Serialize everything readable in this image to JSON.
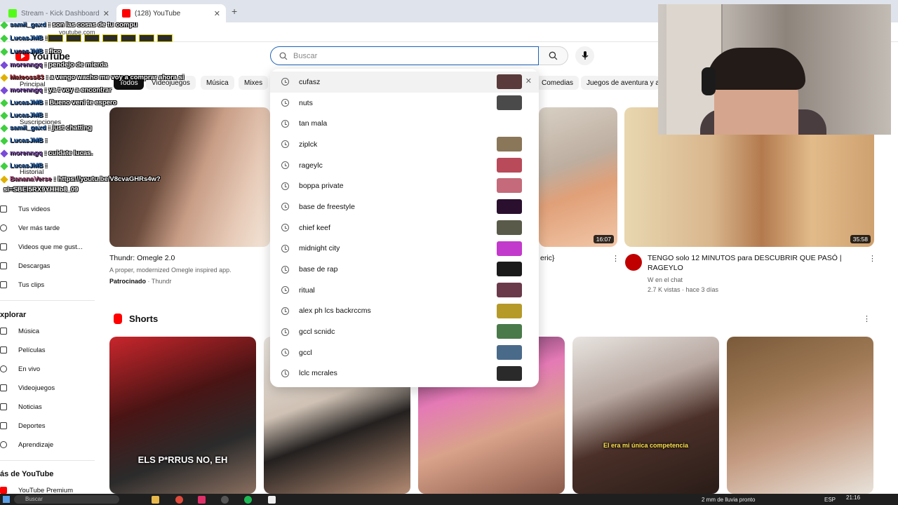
{
  "browser": {
    "tabs": [
      {
        "label": "Stream - Kick Dashboard",
        "color": "#53fc18"
      },
      {
        "label": "(128) YouTube",
        "color": "#ff0000"
      }
    ],
    "url": "youtube.com"
  },
  "header": {
    "logo": "YouTube",
    "search_placeholder": "Buscar"
  },
  "chips": [
    "Todos",
    "Videojuegos",
    "Música",
    "Mixes",
    "Comedias",
    "Juegos de aventura y ac"
  ],
  "sidebar": {
    "top": [
      "Principal",
      "Suscripciones",
      "Historial"
    ],
    "you": [
      "Tus videos",
      "Ver más tarde",
      "Videos que me gust...",
      "Descargas",
      "Tus clips"
    ],
    "explore_heading": "xplorar",
    "explore": [
      "Música",
      "Películas",
      "En vivo",
      "Videojuegos",
      "Noticias",
      "Deportes",
      "Aprendizaje"
    ],
    "more_heading": "ás de YouTube",
    "more": [
      "YouTube Premium"
    ]
  },
  "suggestions": [
    {
      "text": "cufasz",
      "remove": "✕"
    },
    {
      "text": "nuts"
    },
    {
      "text": "tan mala"
    },
    {
      "text": "ziplck"
    },
    {
      "text": "rageylc"
    },
    {
      "text": "boppa private"
    },
    {
      "text": "base de freestyle"
    },
    {
      "text": "chief keef"
    },
    {
      "text": "midnight city"
    },
    {
      "text": "base de rap"
    },
    {
      "text": "ritual"
    },
    {
      "text": "alex ph lcs backrccms"
    },
    {
      "text": "gccl scnidc"
    },
    {
      "text": "gccl"
    },
    {
      "text": "lclc mcrales"
    }
  ],
  "videos": {
    "ad": {
      "title": "Thundr: Omegle 2.0",
      "desc": "A proper, modernized Omegle inspired app.",
      "sponsored": "Patrocinado",
      "channel": "Thundr"
    },
    "middle": {
      "title_fragment": "eric}",
      "duration": "16:07"
    },
    "right": {
      "title": "TENGO solo 12 MINUTOS para DESCUBRIR QUE PASÓ | RAGEYLO",
      "channel": "W en el chat",
      "meta": "2.7 K vistas · hace 3 días",
      "duration": "35:58"
    }
  },
  "shorts": {
    "heading": "Shorts",
    "captions": [
      "ELS P*RRUS NO, EH",
      "",
      "",
      "El era mi única competencia",
      ""
    ]
  },
  "chat": [
    {
      "user": "samil_gaxd",
      "text": ": son las cosas de tu compu"
    },
    {
      "user": "LucasJMB",
      "text": ":"
    },
    {
      "user": "LucasJMB",
      "text": ": fico"
    },
    {
      "user": "Mateoss83",
      "text": ": a vengo wacho me voy a comprar ahora si"
    },
    {
      "user": "morenngq",
      "text": ": pendejo de mierda"
    },
    {
      "user": "morenngq",
      "text": ": ya t voy a encontrar"
    },
    {
      "user": "LucasJMB",
      "text": ": Bueno veni te espero"
    },
    {
      "user": "LucasJMB",
      "text": ":"
    },
    {
      "user": "samil_gaxd",
      "text": ": just chatting"
    },
    {
      "user": "LucasJMB",
      "text": ":"
    },
    {
      "user": "morenngq",
      "text": ": cuidate lucas."
    },
    {
      "user": "LucasJMB",
      "text": ":"
    },
    {
      "user": "BananaVerse",
      "text": ": https://youtu.be/V8cvaGHRs4w?"
    },
    {
      "user": "",
      "text": "si=SBEI5RX9YHHb8_09"
    }
  ],
  "taskbar": {
    "search": "Buscar",
    "weather": "2 mm de lluvia pronto",
    "lang": "ESP",
    "time": "21:16"
  }
}
